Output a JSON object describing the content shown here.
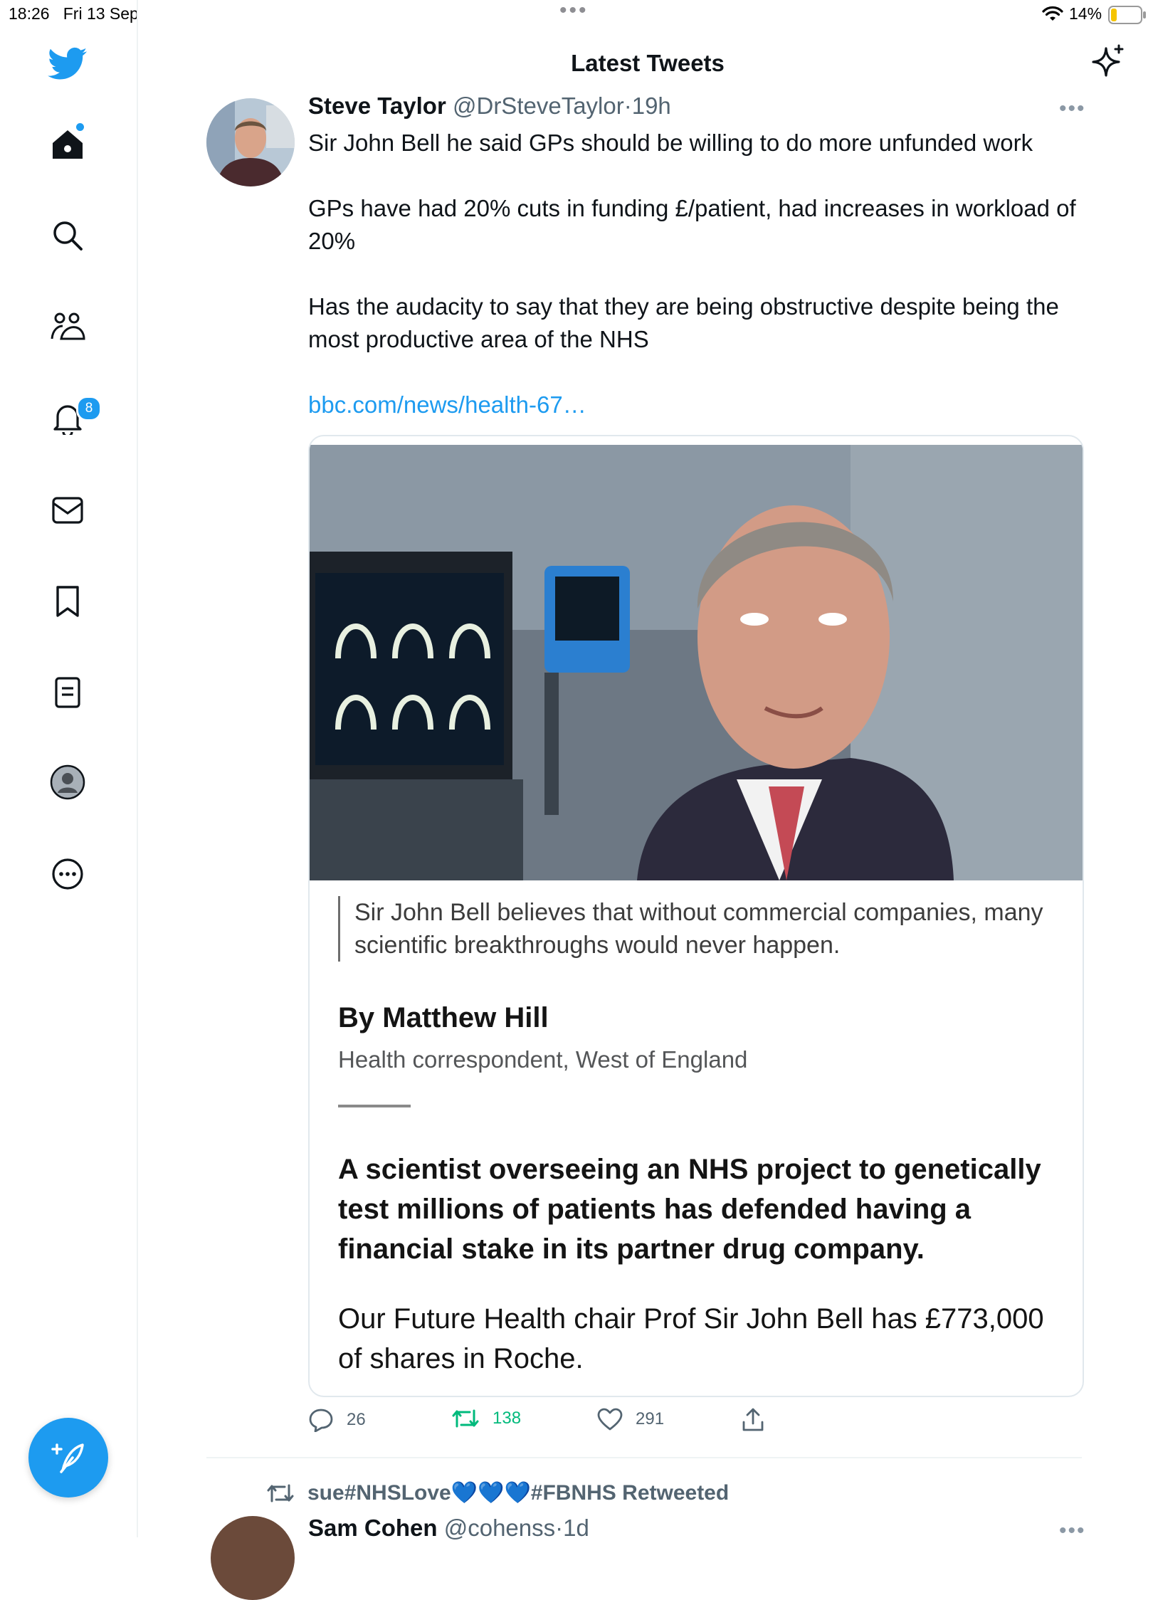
{
  "status_bar": {
    "time": "18:26",
    "date": "Fri 13 Sep",
    "battery": "14%"
  },
  "header": {
    "title": "Latest Tweets"
  },
  "sidebar": {
    "notifications_count": "8",
    "icons": [
      "twitter-logo-icon",
      "home-icon",
      "search-icon",
      "communities-icon",
      "notifications-bell-icon",
      "messages-icon",
      "bookmark-icon",
      "lists-icon",
      "profile-icon",
      "more-icon"
    ]
  },
  "tweet": {
    "name": "Steve Taylor",
    "handle": "@DrSteveTaylor",
    "separator": "·",
    "time": "19h",
    "more": "•••",
    "paragraphs": [
      "Sir John Bell he said GPs should be willing to do more unfunded work",
      "GPs have had 20% cuts in funding £/patient, had increases in workload of 20%",
      "Has the audacity to say that they are being obstructive despite being the most productive area of the NHS"
    ],
    "link": "bbc.com/news/health-67…",
    "card": {
      "caption": "Sir John Bell believes that without commercial companies, many scientific breakthroughs would never happen.",
      "byline": "By Matthew Hill",
      "role": "Health correspondent, West of England",
      "lede": "A scientist overseeing an NHS project to genetically test millions of patients has defended having a financial stake in its partner drug company.",
      "body": "Our Future Health chair Prof Sir John Bell has £773,000 of shares in Roche."
    },
    "actions": {
      "replies": "26",
      "retweets": "138",
      "likes": "291"
    }
  },
  "next_tweet": {
    "retweeted_by": "sue#NHSLove💙💙💙#FBNHS Retweeted",
    "name": "Sam Cohen",
    "handle": "@cohenss",
    "separator": "·",
    "time": "1d",
    "more": "•••"
  },
  "colors": {
    "accent": "#1d9bf0",
    "retweet_green": "#00ba7c",
    "text": "#0f1419",
    "muted": "#536471"
  }
}
